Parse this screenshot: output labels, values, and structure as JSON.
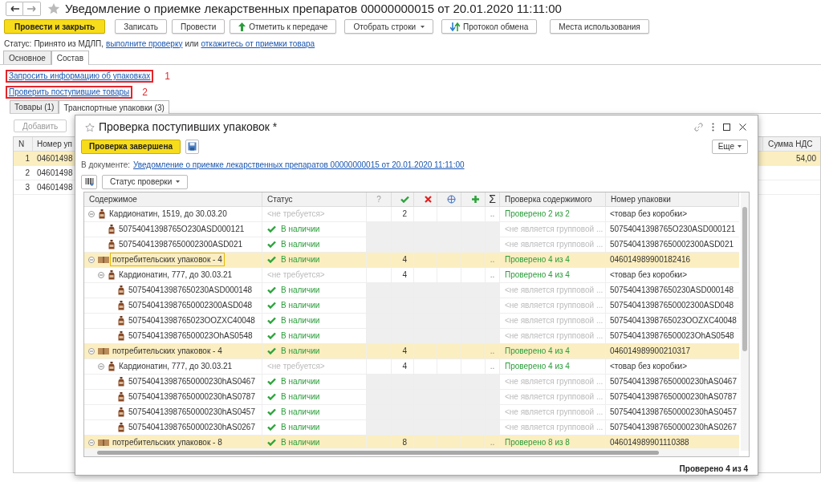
{
  "document": {
    "title": "Уведомление о приемке лекарственных препаратов 00000000015 от 20.01.2020 11:11:00",
    "buttons": [
      {
        "label": "Провести и закрыть",
        "kind": "primary"
      },
      {
        "label": "Записать",
        "kind": "plain"
      },
      {
        "label": "Провести",
        "kind": "plain"
      },
      {
        "label": "Отметить к передаче",
        "kind": "arrow"
      },
      {
        "label": "Отобрать строки",
        "kind": "dropdown"
      },
      {
        "label": "Протокол обмена",
        "kind": "exchange"
      },
      {
        "label": "Места использования",
        "kind": "plain"
      }
    ],
    "status": {
      "label": "Статус:",
      "text": "Принято из МДЛП,",
      "link1": "выполните проверку",
      "middle": "или",
      "link2": "откажитесь от приемки товара"
    },
    "tabs": [
      {
        "label": "Основное",
        "selected": false
      },
      {
        "label": "Состав",
        "selected": true
      }
    ],
    "links": [
      {
        "label": "Запросить информацию об упаковках",
        "marker": "1"
      },
      {
        "label": "Проверить поступившие товары",
        "marker": "2"
      }
    ],
    "inner_tabs": [
      {
        "label": "Товары (1)",
        "selected": false
      },
      {
        "label": "Транспортные упаковки (3)",
        "selected": true
      }
    ],
    "add_button": "Добавить",
    "table": {
      "columns": [
        "N",
        "Номер уп"
      ],
      "right_column": "Сумма НДС",
      "rows": [
        {
          "n": "1",
          "number": "04601498",
          "vat": "54,00",
          "selected": true
        },
        {
          "n": "2",
          "number": "04601498",
          "vat": "",
          "selected": false
        },
        {
          "n": "3",
          "number": "04601498",
          "vat": "",
          "selected": false
        }
      ]
    }
  },
  "dialog": {
    "title": "Проверка поступивших упаковок *",
    "done_button": "Проверка завершена",
    "more_button": "Еще",
    "document_label": "В документе:",
    "document_link": "Уведомление о приемке лекарственных препаратов 00000000015 от 20.01.2020 11:11:00",
    "filter_button": "Статус проверки",
    "columns": [
      {
        "kind": "text",
        "label": "Содержимое"
      },
      {
        "kind": "text",
        "label": "Статус"
      },
      {
        "kind": "text",
        "label": "?"
      },
      {
        "kind": "check"
      },
      {
        "kind": "cross"
      },
      {
        "kind": "globe"
      },
      {
        "kind": "plus"
      },
      {
        "kind": "text",
        "label": "Σ"
      },
      {
        "kind": "text",
        "label": "Проверка содержимого"
      },
      {
        "kind": "text",
        "label": "Номер упаковки"
      }
    ],
    "rows": [
      {
        "kind": "product",
        "content": "Кардионатин, 1519, до 30.03.20",
        "expanded": true,
        "selected": false,
        "status": "<не требуется>",
        "count": "2",
        "sum": "..",
        "check": "Проверено 2 из 2",
        "number": "<товар без коробки>",
        "children": [
          {
            "kind": "item",
            "content": "50754041398765O230ASD000121",
            "selected": false,
            "status": "В наличии",
            "check": "<не является групповой ...",
            "number": "50754041398765O230ASD000121"
          },
          {
            "kind": "item",
            "content": "507540413987650002300ASD021",
            "selected": false,
            "status": "В наличии",
            "check": "<не является групповой ...",
            "number": "507540413987650002300ASD021"
          }
        ]
      },
      {
        "kind": "group",
        "content": "потребительских упаковок -  4",
        "expanded": true,
        "selected": true,
        "status": "В наличии",
        "count": "4",
        "sum": "..",
        "check": "Проверено 4 из 4",
        "number": "046014989900182416",
        "children": [
          {
            "kind": "product",
            "content": "Кардионатин, 777, до 30.03.21",
            "expanded": true,
            "selected": false,
            "status": "<не требуется>",
            "count": "4",
            "sum": "..",
            "check": "Проверено 4 из 4",
            "number": "<товар без коробки>",
            "children": [
              {
                "kind": "item",
                "content": "507540413987650230ASD000148",
                "selected": false,
                "status": "В наличии",
                "check": "<не является групповой ...",
                "number": "507540413987650230ASD000148"
              },
              {
                "kind": "item",
                "content": "507540413987650002300ASD048",
                "selected": false,
                "status": "В наличии",
                "check": "<не является групповой ...",
                "number": "507540413987650002300ASD048"
              },
              {
                "kind": "item",
                "content": "50754041398765023OOZXC40048",
                "selected": false,
                "status": "В наличии",
                "check": "<не является групповой ...",
                "number": "50754041398765023OOZXC40048"
              },
              {
                "kind": "item",
                "content": "5075404139876500023OhAS0548",
                "selected": false,
                "status": "В наличии",
                "check": "<не является групповой ...",
                "number": "5075404139876500023OhAS0548"
              }
            ]
          }
        ]
      },
      {
        "kind": "group",
        "content": "потребительских упаковок -  4",
        "expanded": true,
        "selected": false,
        "status": "В наличии",
        "count": "4",
        "sum": "..",
        "check": "Проверено 4 из 4",
        "number": "046014989900210317",
        "children": [
          {
            "kind": "product",
            "content": "Кардионатин, 777, до 30.03.21",
            "expanded": true,
            "selected": false,
            "status": "<не требуется>",
            "count": "4",
            "sum": "..",
            "check": "Проверено 4 из 4",
            "number": "<товар без коробки>",
            "children": [
              {
                "kind": "item",
                "content": "507540413987650000230hAS0467",
                "selected": false,
                "status": "В наличии",
                "check": "<не является групповой ...",
                "number": "507540413987650000230hAS0467"
              },
              {
                "kind": "item",
                "content": "507540413987650000230hAS0787",
                "selected": false,
                "status": "В наличии",
                "check": "<не является групповой ...",
                "number": "507540413987650000230hAS0787"
              },
              {
                "kind": "item",
                "content": "507540413987650000230hAS0457",
                "selected": false,
                "status": "В наличии",
                "check": "<не является групповой ...",
                "number": "507540413987650000230hAS0457"
              },
              {
                "kind": "item",
                "content": "507540413987650000230hAS0267",
                "selected": false,
                "status": "В наличии",
                "check": "<не является групповой ...",
                "number": "507540413987650000230hAS0267"
              }
            ]
          }
        ]
      },
      {
        "kind": "group",
        "content": "потребительских упаковок -  8",
        "expanded": true,
        "selected": false,
        "status": "В наличии",
        "count": "8",
        "sum": "..",
        "check": "Проверено 8 из 8",
        "number": "046014989901110388"
      }
    ],
    "footer": "Проверено 4 из 4"
  }
}
